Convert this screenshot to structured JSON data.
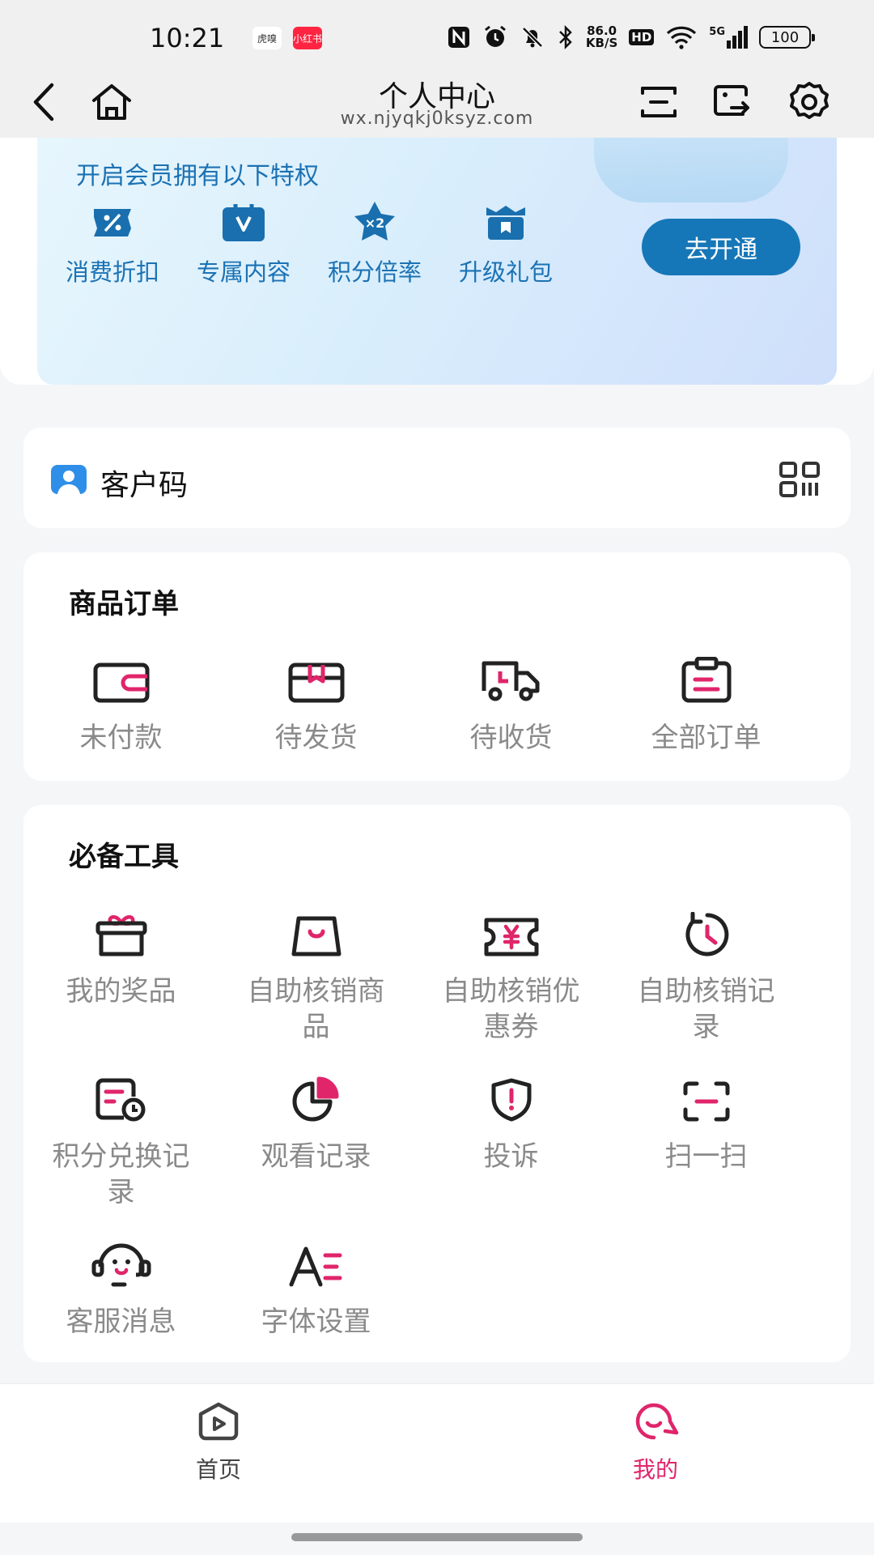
{
  "status": {
    "time": "10:21",
    "app1": "虎嗅",
    "app2": "小红书",
    "speed_value": "86.0",
    "speed_unit": "KB/S",
    "hd": "HD",
    "network": "5G",
    "battery": "100"
  },
  "nav": {
    "title": "个人中心",
    "url": "wx.njyqkj0ksyz.com"
  },
  "vip": {
    "subtitle": "开启会员拥有以下特权",
    "perks": [
      {
        "label": "消费折扣",
        "icon": "discount-icon"
      },
      {
        "label": "专属内容",
        "icon": "exclusive-icon"
      },
      {
        "label": "积分倍率",
        "icon": "points-multiplier-icon"
      },
      {
        "label": "升级礼包",
        "icon": "gift-package-icon"
      }
    ],
    "open_button": "去开通"
  },
  "customer_code": {
    "label": "客户码"
  },
  "orders": {
    "title": "商品订单",
    "items": [
      {
        "label": "未付款",
        "icon": "wallet-icon"
      },
      {
        "label": "待发货",
        "icon": "box-icon"
      },
      {
        "label": "待收货",
        "icon": "truck-icon"
      },
      {
        "label": "全部订单",
        "icon": "clipboard-icon"
      }
    ]
  },
  "tools": {
    "title": "必备工具",
    "items": [
      {
        "label": "我的奖品",
        "icon": "prize-icon"
      },
      {
        "label": "自助核销商品",
        "icon": "bag-icon"
      },
      {
        "label": "自助核销优惠券",
        "icon": "coupon-icon"
      },
      {
        "label": "自助核销记录",
        "icon": "history-icon"
      },
      {
        "label": "积分兑换记录",
        "icon": "points-record-icon"
      },
      {
        "label": "观看记录",
        "icon": "pie-icon"
      },
      {
        "label": "投诉",
        "icon": "complaint-icon"
      },
      {
        "label": "扫一扫",
        "icon": "scan-icon"
      },
      {
        "label": "客服消息",
        "icon": "service-icon"
      },
      {
        "label": "字体设置",
        "icon": "font-icon"
      }
    ]
  },
  "tabs": [
    {
      "label": "首页",
      "icon": "home-video-icon"
    },
    {
      "label": "我的",
      "icon": "mine-icon"
    }
  ],
  "colors": {
    "accent": "#e0256b",
    "vip_blue": "#1677b8",
    "muted": "#8a8a8a"
  }
}
